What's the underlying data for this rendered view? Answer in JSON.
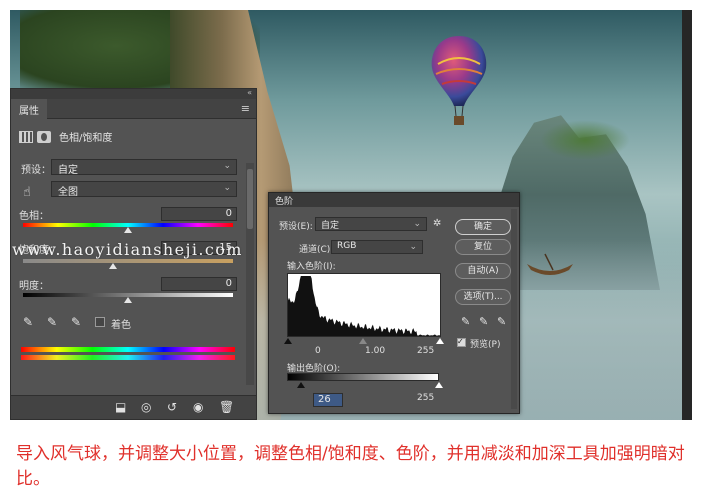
{
  "properties_panel": {
    "tab_label": "属性",
    "collapse_glyph": "«",
    "menu_glyph": "≡",
    "adjustment_title": "色相/饱和度",
    "preset_label": "预设：",
    "preset_value": "自定",
    "channel_value": "全图",
    "hue_label": "色相：",
    "hue_value": "0",
    "saturation_label": "饱和度：",
    "saturation_value": "-15",
    "lightness_label": "明度：",
    "lightness_value": "0",
    "colorize_label": "着色",
    "hue_level": 0.5,
    "saturation_level": 0.43,
    "lightness_level": 0.5
  },
  "levels_dialog": {
    "title": "色阶",
    "preset_label": "预设(E):",
    "preset_value": "自定",
    "channel_label": "通道(C):",
    "channel_value": "RGB",
    "input_label": "输入色阶(I):",
    "input_black": "0",
    "input_gamma": "1.00",
    "input_white": "255",
    "output_label": "输出色阶(O):",
    "output_black": "26",
    "output_white": "255",
    "buttons": {
      "ok": "确定",
      "reset": "复位",
      "auto": "自动(A)",
      "options": "选项(T)..."
    },
    "preview_label": "预览(P)",
    "preview_checked": true
  },
  "watermark": "www.haoyidiansheji.com",
  "caption": "导入风气球，并调整大小位置，调整色相/饱和度、色阶，并用减淡和加深工具加强明暗对比。",
  "icons": [
    "dropper-icon",
    "dropper-plus-icon",
    "dropper-minus-icon",
    "hand-target-icon",
    "eye-icon",
    "trash-icon",
    "reset-icon",
    "clip-icon",
    "view-previous-icon"
  ]
}
